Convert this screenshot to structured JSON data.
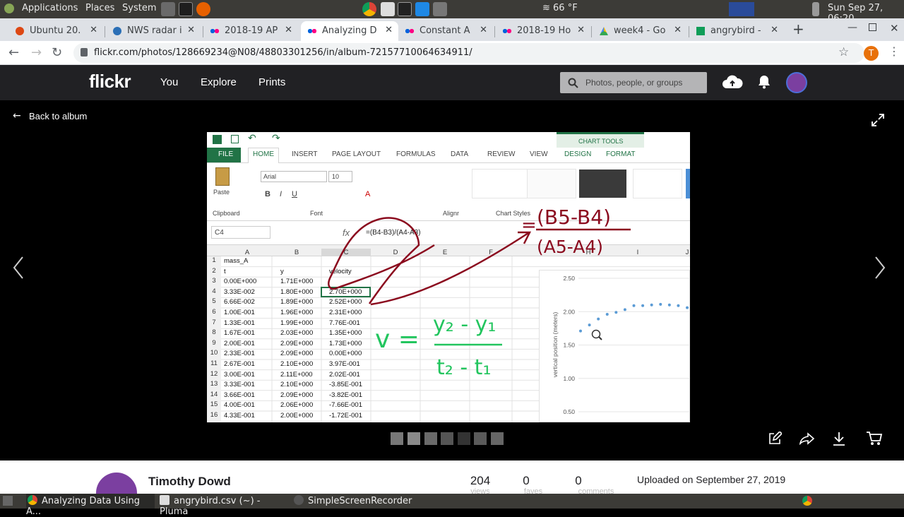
{
  "panel": {
    "applications": "Applications",
    "places": "Places",
    "system": "System",
    "weather": "≋ 66 °F",
    "clock": "Sun Sep 27, 06:20"
  },
  "tabs": [
    {
      "label": "Ubuntu 20.",
      "color": "#dd4814"
    },
    {
      "label": "NWS radar i",
      "color": "#2b6fb6"
    },
    {
      "label": "2018-19 AP",
      "color": "#ff0084"
    },
    {
      "label": "Analyzing D",
      "color": "#ff0084"
    },
    {
      "label": "Constant A",
      "color": "#ff0084"
    },
    {
      "label": "2018-19 Ho",
      "color": "#ff0084"
    },
    {
      "label": "week4 - Go",
      "color": "#1a73e8"
    },
    {
      "label": "angrybird -",
      "color": "#0f9d58"
    }
  ],
  "address": {
    "url": "flickr.com/photos/128669234@N08/48803301256/in/album-72157710064634911/",
    "profile_initial": "T"
  },
  "flickr": {
    "logo": "flickr",
    "nav": [
      "You",
      "Explore",
      "Prints"
    ],
    "search_placeholder": "Photos, people, or groups"
  },
  "viewer": {
    "back_label": "Back to album"
  },
  "excel": {
    "tabs": [
      "FILE",
      "HOME",
      "INSERT",
      "PAGE LAYOUT",
      "FORMULAS",
      "DATA",
      "REVIEW",
      "VIEW",
      "DESIGN",
      "FORMAT"
    ],
    "chart_tools": "CHART TOOLS",
    "font_name": "Arial",
    "font_size": "10",
    "paste": "Paste",
    "group_labels": [
      "Clipboard",
      "Font",
      "Alignr",
      "Chart Styles"
    ],
    "name_box": "C4",
    "formula": "=(B4-B3)/(A4-A3)",
    "columns": [
      "A",
      "B",
      "C",
      "D",
      "E",
      "F",
      "H",
      "I",
      "J"
    ],
    "rows": [
      {
        "n": "1",
        "a": "mass_A",
        "b": "",
        "c": ""
      },
      {
        "n": "2",
        "a": "t",
        "b": "y",
        "c": "velocity"
      },
      {
        "n": "3",
        "a": "0.00E+000",
        "b": "1.71E+000",
        "c": ""
      },
      {
        "n": "4",
        "a": "3.33E-002",
        "b": "1.80E+000",
        "c": "2.70E+000"
      },
      {
        "n": "5",
        "a": "6.66E-002",
        "b": "1.89E+000",
        "c": "2.52E+000"
      },
      {
        "n": "6",
        "a": "1.00E-001",
        "b": "1.96E+000",
        "c": "2.31E+000"
      },
      {
        "n": "7",
        "a": "1.33E-001",
        "b": "1.99E+000",
        "c": "7.76E-001"
      },
      {
        "n": "8",
        "a": "1.67E-001",
        "b": "2.03E+000",
        "c": "1.35E+000"
      },
      {
        "n": "9",
        "a": "2.00E-001",
        "b": "2.09E+000",
        "c": "1.73E+000"
      },
      {
        "n": "10",
        "a": "2.33E-001",
        "b": "2.09E+000",
        "c": "0.00E+000"
      },
      {
        "n": "11",
        "a": "2.67E-001",
        "b": "2.10E+000",
        "c": "3.97E-001"
      },
      {
        "n": "12",
        "a": "3.00E-001",
        "b": "2.11E+000",
        "c": "2.02E-001"
      },
      {
        "n": "13",
        "a": "3.33E-001",
        "b": "2.10E+000",
        "c": "-3.85E-001"
      },
      {
        "n": "14",
        "a": "3.66E-001",
        "b": "2.09E+000",
        "c": "-3.82E-001"
      },
      {
        "n": "15",
        "a": "4.00E-001",
        "b": "2.06E+000",
        "c": "-7.66E-001"
      },
      {
        "n": "16",
        "a": "4.33E-001",
        "b": "2.00E+000",
        "c": "-1.72E-001"
      }
    ],
    "chart_axis_title": "vertical position (meters)",
    "chart_ticks": [
      "2.50",
      "2.00",
      "1.50",
      "1.00",
      "0.50"
    ],
    "chart_points": [
      1.71,
      1.8,
      1.89,
      1.96,
      1.99,
      2.03,
      2.09,
      2.09,
      2.1,
      2.11,
      2.1,
      2.09,
      2.06
    ]
  },
  "annotations": {
    "top_num": "(B5-B4)",
    "top_den": "(A5-A4)",
    "eq_left": "v =",
    "eq_num": "y₂ - y₁",
    "eq_den": "t₂ - t₁"
  },
  "info": {
    "owner": "Timothy Dowd",
    "views": "204",
    "views_label": "views",
    "faves": "0",
    "faves_label": "faves",
    "comments": "0",
    "comments_label": "comments",
    "uploaded": "Uploaded on September 27, 2019"
  },
  "taskbar": {
    "items": [
      "Analyzing Data Using A...",
      "angrybird.csv (~) - Pluma",
      "SimpleScreenRecorder"
    ]
  }
}
